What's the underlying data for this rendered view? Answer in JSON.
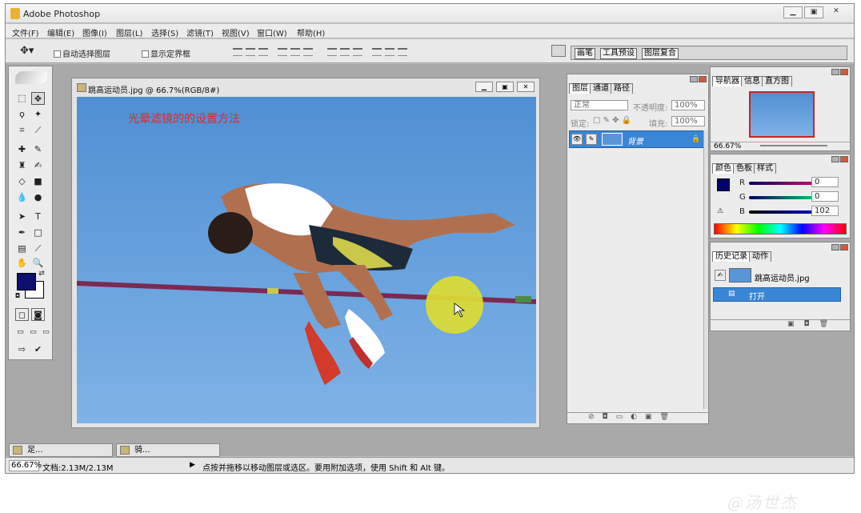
{
  "app": {
    "title": "Adobe Photoshop"
  },
  "menu": [
    "文件(F)",
    "编辑(E)",
    "图像(I)",
    "图层(L)",
    "选择(S)",
    "滤镜(T)",
    "视图(V)",
    "窗口(W)",
    "帮助(H)"
  ],
  "options": {
    "auto_select": "自动选择图层",
    "show_bounds": "显示定界框"
  },
  "well_tabs": [
    "画笔",
    "工具预设",
    "图层复合"
  ],
  "document": {
    "title": "跳高运动员.jpg @ 66.7%(RGB/8#)",
    "caption": "光晕滤镜的的设置方法"
  },
  "layers_panel": {
    "tabs": [
      "图层",
      "通道",
      "路径"
    ],
    "blend_mode": "正常",
    "opacity_label": "不透明度:",
    "opacity": "100%",
    "lock_label": "锁定:",
    "fill_label": "填充:",
    "fill": "100%",
    "layer_name": "背景"
  },
  "navigator_panel": {
    "tabs": [
      "导航器",
      "信息",
      "直方图"
    ],
    "zoom": "66.67%"
  },
  "color_panel": {
    "tabs": [
      "颜色",
      "色板",
      "样式"
    ],
    "channels": [
      {
        "label": "R",
        "value": "0"
      },
      {
        "label": "G",
        "value": "0"
      },
      {
        "label": "B",
        "value": "102"
      }
    ],
    "fg_color": "#000066"
  },
  "history_panel": {
    "tabs": [
      "历史记录",
      "动作"
    ],
    "snapshot": "跳高运动员.jpg",
    "step": "打开"
  },
  "minimized": [
    "足...",
    "骑..."
  ],
  "status": {
    "zoom": "66.67%",
    "doc_size": "文档:2.13M/2.13M",
    "hint": "点按并拖移以移动图层或选区。要用附加选项，使用 Shift 和 Alt 键。"
  },
  "watermark": "@汤世杰"
}
